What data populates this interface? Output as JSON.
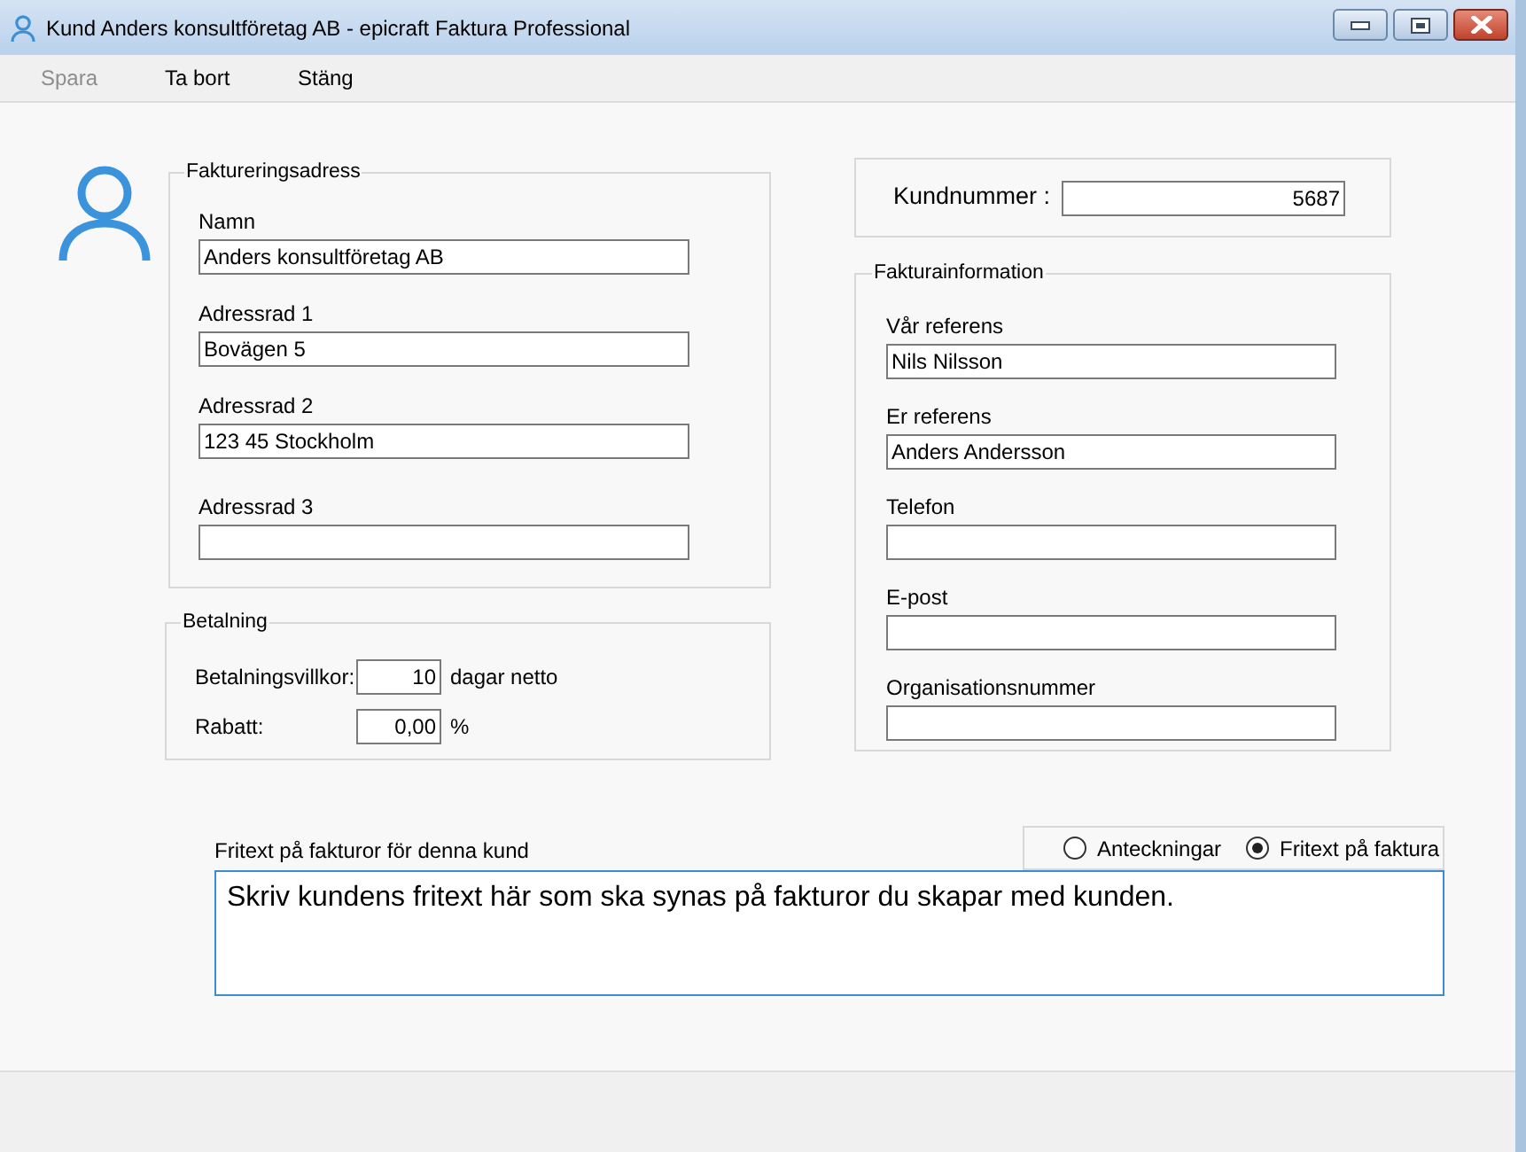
{
  "window": {
    "title": "Kund Anders konsultföretag AB - epicraft Faktura Professional"
  },
  "toolbar": [
    {
      "label": "Spara",
      "disabled": true
    },
    {
      "label": "Ta bort",
      "disabled": false
    },
    {
      "label": "Stäng",
      "disabled": false
    }
  ],
  "billing_address": {
    "title": "Faktureringsadress",
    "fields": [
      {
        "label": "Namn",
        "value": "Anders konsultföretag AB"
      },
      {
        "label": "Adressrad 1",
        "value": "Bovägen 5"
      },
      {
        "label": "Adressrad 2",
        "value": "123 45 Stockholm"
      },
      {
        "label": "Adressrad 3"
      }
    ]
  },
  "payment": {
    "title": "Betalning",
    "rows": [
      {
        "label": "Betalningsvillkor:",
        "value": "10",
        "unit": "dagar netto"
      },
      {
        "label": "Rabatt:",
        "value": "0,00",
        "unit": "%"
      }
    ]
  },
  "customer_number": {
    "label": "Kundnummer :",
    "value": "5687"
  },
  "invoice_info": {
    "title": "Fakturainformation",
    "fields": [
      {
        "label": "Vår referens",
        "value": "Nils Nilsson"
      },
      {
        "label": "Er referens",
        "value": "Anders Andersson"
      },
      {
        "label": "Telefon"
      },
      {
        "label": "E-post"
      },
      {
        "label": "Organisationsnummer"
      }
    ]
  },
  "free_text": {
    "label": "Fritext på fakturor för denna kund",
    "options": [
      {
        "label": "Anteckningar",
        "selected": false
      },
      {
        "label": "Fritext på faktura",
        "selected": true
      }
    ],
    "value": "Skriv kundens fritext här som ska synas på fakturor du skapar med kunden."
  }
}
